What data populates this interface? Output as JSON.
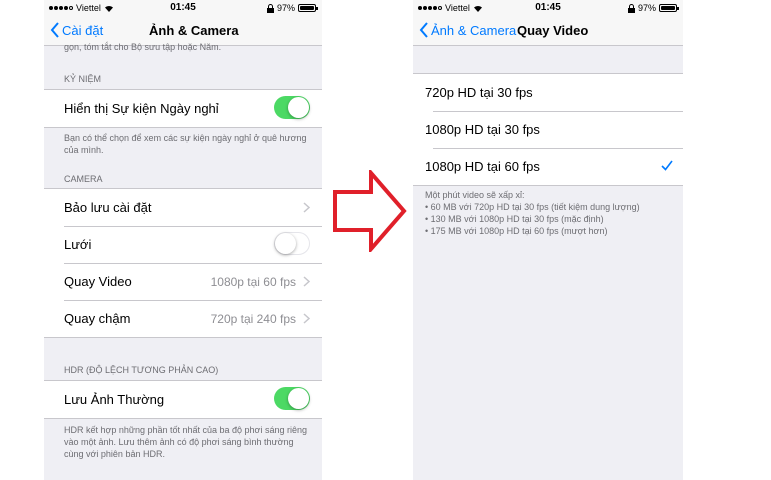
{
  "left": {
    "status": {
      "carrier": "Viettel",
      "time": "01:45",
      "battery": "97%"
    },
    "nav": {
      "back": "Cài đặt",
      "title": "Ảnh & Camera"
    },
    "top_footer": "gọn, tóm tắt cho Bộ sưu tập hoặc Năm.",
    "memories": {
      "header": "KỶ NIỆM",
      "row": {
        "label": "Hiển thị Sự kiện Ngày nghỉ",
        "toggle": true
      },
      "footer": "Bạn có thể chọn để xem các sự kiện ngày nghỉ ở quê hương của mình."
    },
    "camera": {
      "header": "CAMERA",
      "rows": [
        {
          "label": "Bảo lưu cài đặt",
          "value": ""
        },
        {
          "label": "Lưới",
          "toggle": false
        },
        {
          "label": "Quay Video",
          "value": "1080p tại 60 fps"
        },
        {
          "label": "Quay chậm",
          "value": "720p tại 240 fps"
        }
      ]
    },
    "hdr": {
      "header": "HDR (ĐỘ LỆCH TƯƠNG PHẢN CAO)",
      "row": {
        "label": "Lưu Ảnh Thường",
        "toggle": true
      },
      "footer": "HDR kết hợp những phần tốt nhất của ba độ phơi sáng riêng vào một ảnh. Lưu thêm ảnh có độ phơi sáng bình thường cùng với phiên bản HDR."
    }
  },
  "right": {
    "status": {
      "carrier": "Viettel",
      "time": "01:45",
      "battery": "97%"
    },
    "nav": {
      "back": "Ảnh & Camera",
      "title": "Quay Video"
    },
    "options": [
      {
        "label": "720p HD tại 30 fps",
        "selected": false
      },
      {
        "label": "1080p HD tại 30 fps",
        "selected": false
      },
      {
        "label": "1080p HD tại 60 fps",
        "selected": true
      }
    ],
    "footer": {
      "intro": "Một phút video sẽ xấp xỉ:",
      "lines": [
        "• 60 MB với 720p HD tại 30 fps (tiết kiệm dung lượng)",
        "• 130 MB với 1080p HD tại 30 fps (mặc định)",
        "• 175 MB với 1080p HD tại 60 fps (mượt hơn)"
      ]
    }
  },
  "colors": {
    "accent": "#007aff",
    "toggle_on": "#4cd964",
    "arrow": "#e0202a"
  }
}
